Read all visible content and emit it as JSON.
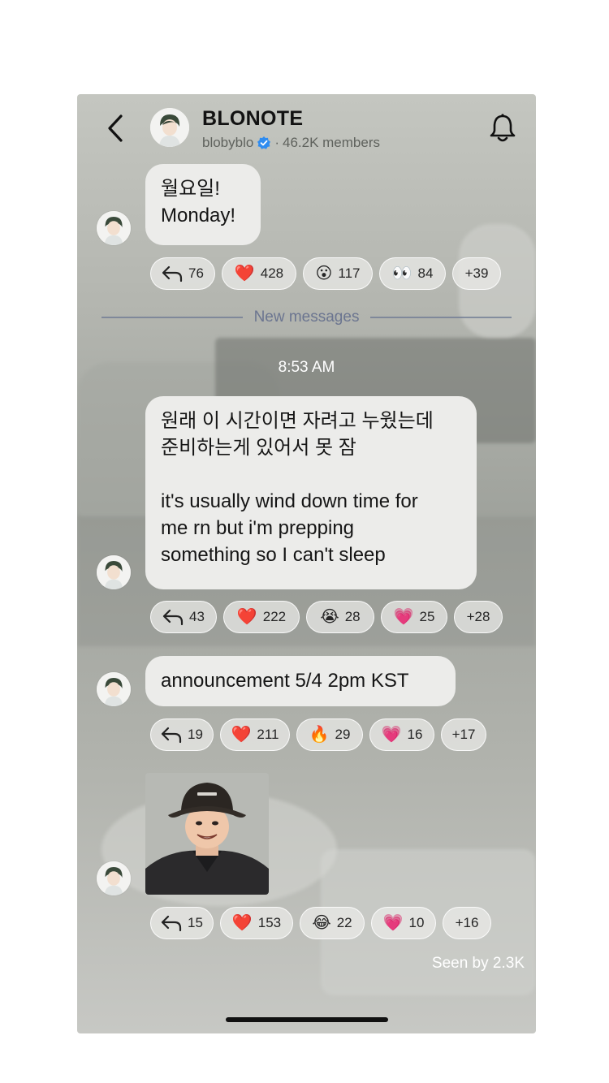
{
  "header": {
    "title": "BLONOTE",
    "handle": "blobyblo",
    "separator": "·",
    "members": "46.2K members",
    "verified_color": "#2f8cf0"
  },
  "divider_label": "New messages",
  "timestamp": "8:53 AM",
  "messages": [
    {
      "text": "월요일!\nMonday!",
      "reactions": [
        {
          "icon": "reply-icon",
          "count": "76"
        },
        {
          "emoji": "❤️",
          "count": "428"
        },
        {
          "emoji": "😮",
          "count": "117"
        },
        {
          "emoji": "👀",
          "count": "84"
        },
        {
          "count": "+39"
        }
      ]
    },
    {
      "text": "원래 이 시간이면 자려고 누웠는데\n준비하는게 있어서 못 잠\n\nit's usually wind down time for\nme rn but i'm prepping\nsomething so I can't sleep",
      "reactions": [
        {
          "icon": "reply-icon",
          "count": "43"
        },
        {
          "emoji": "❤️",
          "count": "222"
        },
        {
          "emoji": "😭",
          "count": "28"
        },
        {
          "emoji": "💗",
          "count": "25"
        },
        {
          "count": "+28"
        }
      ]
    },
    {
      "text": "announcement 5/4 2pm KST",
      "reactions": [
        {
          "icon": "reply-icon",
          "count": "19"
        },
        {
          "emoji": "❤️",
          "count": "211"
        },
        {
          "emoji": "🔥",
          "count": "29"
        },
        {
          "emoji": "💗",
          "count": "16"
        },
        {
          "count": "+17"
        }
      ]
    },
    {
      "sticker": "sticker-photo-bucket-hat",
      "reactions": [
        {
          "icon": "reply-icon",
          "count": "15"
        },
        {
          "emoji": "❤️",
          "count": "153"
        },
        {
          "emoji": "😂",
          "count": "22"
        },
        {
          "emoji": "💗",
          "count": "10"
        },
        {
          "count": "+16"
        }
      ]
    }
  ],
  "seen_by": "Seen by 2.3K"
}
